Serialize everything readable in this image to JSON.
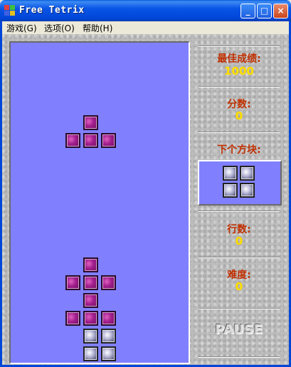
{
  "window": {
    "title": "Free Tetrix",
    "minimize_glyph": "_",
    "maximize_glyph": "□",
    "close_glyph": "×"
  },
  "menu": {
    "items": [
      "游戏(G)",
      "选项(O)",
      "帮助(H)"
    ]
  },
  "stats": {
    "best_label": "最佳成绩:",
    "best_value": "1000",
    "score_label": "分数:",
    "score_value": "0",
    "next_label": "下个方块:",
    "lines_label": "行数:",
    "lines_value": "0",
    "level_label": "难度:",
    "level_value": "0",
    "pause_label": "PAUSE"
  },
  "board": {
    "columns": 10,
    "rows": 18,
    "colors": {
      "magenta": "#A01E8C",
      "silver": "#B8B8D8",
      "background": "#8080FF"
    },
    "falling_piece": {
      "color": "magenta",
      "cells": [
        [
          4,
          4
        ],
        [
          3,
          5
        ],
        [
          4,
          5
        ],
        [
          5,
          5
        ]
      ]
    },
    "stack": [
      {
        "color": "magenta",
        "cells": [
          [
            4,
            12
          ],
          [
            3,
            13
          ],
          [
            4,
            13
          ],
          [
            5,
            13
          ],
          [
            4,
            14
          ],
          [
            3,
            15
          ],
          [
            4,
            15
          ],
          [
            5,
            15
          ]
        ]
      },
      {
        "color": "silver",
        "cells": [
          [
            4,
            16
          ],
          [
            5,
            16
          ],
          [
            4,
            17
          ],
          [
            5,
            17
          ]
        ]
      }
    ]
  },
  "next_piece": {
    "color": "silver",
    "cells": [
      [
        0,
        0
      ],
      [
        1,
        0
      ],
      [
        0,
        1
      ],
      [
        1,
        1
      ]
    ]
  }
}
